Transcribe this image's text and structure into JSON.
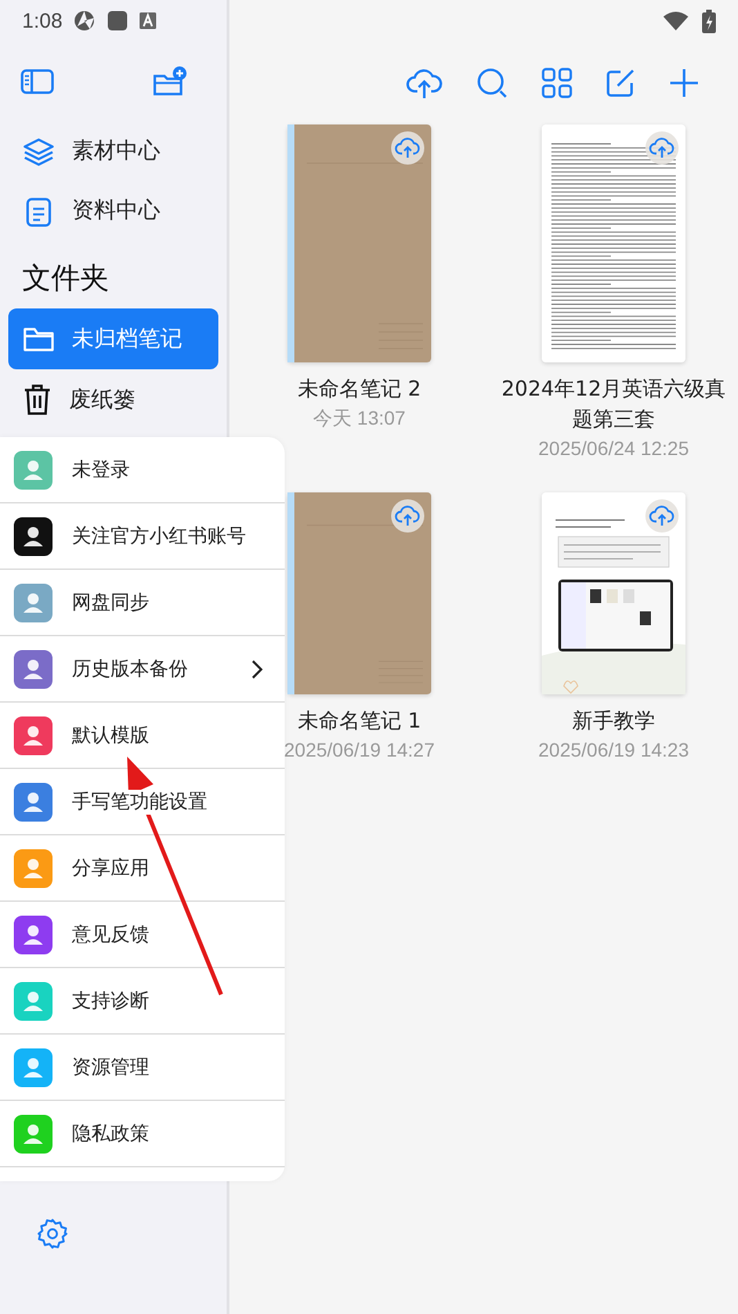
{
  "status_bar": {
    "time": "1:08"
  },
  "sidebar": {
    "items": [
      {
        "label": "素材中心",
        "kind": "layers"
      },
      {
        "label": "资料中心",
        "kind": "document"
      }
    ],
    "folders_heading": "文件夹",
    "folders": [
      {
        "label": "未归档笔记",
        "kind": "folder",
        "selected": true
      },
      {
        "label": "废纸篓",
        "kind": "trash",
        "selected": false
      }
    ]
  },
  "notes": [
    {
      "title": "未命名笔记 2",
      "date": "今天 13:07",
      "kind": "notebook"
    },
    {
      "title": "2024年12月英语六级真题第三套",
      "date": "2025/06/24 12:25",
      "kind": "document"
    },
    {
      "title": "未命名笔记 1",
      "date": "2025/06/19 14:27",
      "kind": "notebook"
    },
    {
      "title": "新手教学",
      "date": "2025/06/19 14:23",
      "kind": "tutorial"
    }
  ],
  "menu": [
    {
      "label": "未登录",
      "color": "#5cc4a4",
      "submenu": false
    },
    {
      "label": "关注官方小红书账号",
      "color": "#111111",
      "submenu": false
    },
    {
      "label": "网盘同步",
      "color": "#7aa9c4",
      "submenu": false
    },
    {
      "label": "历史版本备份",
      "color": "#7b6cc8",
      "submenu": true
    },
    {
      "label": "默认模版",
      "color": "#ef3a5d",
      "submenu": false
    },
    {
      "label": "手写笔功能设置",
      "color": "#3b7fe0",
      "submenu": false
    },
    {
      "label": "分享应用",
      "color": "#fb9a14",
      "submenu": false
    },
    {
      "label": "意见反馈",
      "color": "#8e3cf0",
      "submenu": false
    },
    {
      "label": "支持诊断",
      "color": "#19d3c0",
      "submenu": false
    },
    {
      "label": "资源管理",
      "color": "#14b3f7",
      "submenu": false
    },
    {
      "label": "隐私政策",
      "color": "#1fd11f",
      "submenu": false
    }
  ]
}
